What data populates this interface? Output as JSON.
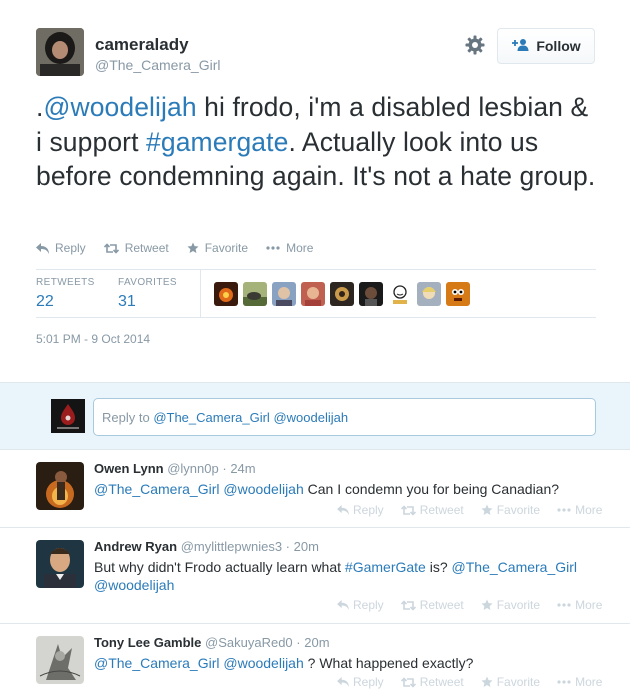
{
  "tweet": {
    "fullname": "cameralady",
    "username": "@The_Camera_Girl",
    "follow_label": "Follow",
    "text_parts": {
      "dot": ".",
      "mention": "@woodelijah",
      "t1": " hi frodo, i'm a disabled lesbian & i support ",
      "hashtag": "#gamergate",
      "t2": ". Actually look into us before condemning again. It's not a hate group."
    },
    "actions": {
      "reply": "Reply",
      "retweet": "Retweet",
      "favorite": "Favorite",
      "more": "More"
    },
    "stats": {
      "retweets_label": "RETWEETS",
      "retweets": "22",
      "favorites_label": "FAVORITES",
      "favorites": "31"
    },
    "timestamp": "5:01 PM - 9 Oct 2014"
  },
  "reply_box": {
    "prefix": "Reply to ",
    "mention1": "@The_Camera_Girl",
    "mention2": " @woodelijah"
  },
  "replies": [
    {
      "name": "Owen Lynn",
      "handle": "@lynn0p",
      "time": "24m",
      "m1": "@The_Camera_Girl",
      "m2": "@woodelijah",
      "text": " Can I condemn you for being Canadian?"
    },
    {
      "name": "Andrew Ryan",
      "handle": "@mylittlepwnies3",
      "time": "20m",
      "t1": "But why didn't Frodo actually learn what ",
      "hashtag": "#GamerGate",
      "t2": " is? ",
      "m1": "@The_Camera_Girl",
      "m2": "@woodelijah"
    },
    {
      "name": "Tony Lee Gamble",
      "handle": "@SakuyaRed0",
      "time": "20m",
      "m1": "@The_Camera_Girl",
      "m2": "@woodelijah",
      "text": " ? What happened exactly?"
    }
  ],
  "colors": {
    "link": "#2b7bb9",
    "muted": "#8899a6",
    "reply_bg": "#eaf4fb",
    "border": "#e1e8ed"
  }
}
